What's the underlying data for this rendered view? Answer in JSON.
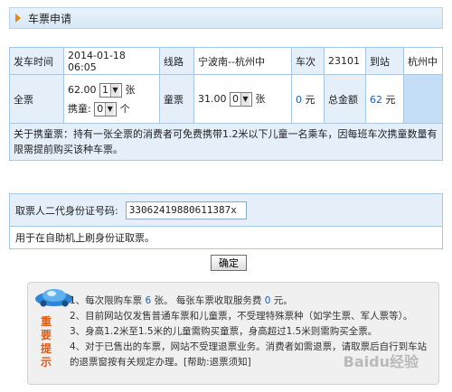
{
  "header": {
    "title": "车票申请"
  },
  "ticket": {
    "depart_time_label": "发车时间",
    "depart_time": "2014-01-18 06:05",
    "route_label": "线路",
    "route": "宁波南--杭州中",
    "train_no_label": "车次",
    "train_no": "23101",
    "arrive_label": "到站",
    "arrive": "杭州中",
    "full_label": "全票",
    "full_price": "62.00",
    "full_qty": "1",
    "full_unit": "张",
    "carry_label": "携童:",
    "carry_qty": "0",
    "carry_unit": "个",
    "child_label": "童票",
    "child_price": "31.00",
    "child_qty": "0",
    "child_unit": "张",
    "child_total": "0",
    "yuan": "元",
    "total_label": "总金额",
    "total_amount": "62",
    "note": "关于携童票：持有一张全票的消费者可免费携带1.2米以下儿童一名乘车，因每班车次携童数量有限需提前购买该种车票。"
  },
  "identity": {
    "label": "取票人二代身份证号码:",
    "value": "33062419880611387x",
    "note": "用于在自助机上刷身份证取票。"
  },
  "confirm_label": "确定",
  "notice": {
    "badge": [
      "重",
      "要",
      "提",
      "示"
    ],
    "line1_a": "1、每次限购车票 ",
    "line1_num": "6",
    "line1_b": " 张。 每张车票收取服务费 ",
    "line1_fee": "0",
    "line1_c": " 元。",
    "line2": "2、目前网站仅发售普通车票和儿童票，不受理特殊票种（如学生票、军人票等）。",
    "line3": "3、身高1.2米至1.5米的儿童需购买童票，身高超过1.5米则需购买全票。",
    "line4": "4、对于已售出的车票，网站不受理退票业务。消费者如需退票，请取票后自行到车站的退票窗按有关规定办理。[帮助:退票须知]",
    "watermark": "Baidu经验"
  },
  "colors": {
    "accent": "#1a5fc5",
    "warning": "#e05a10",
    "cell_label_bg": "#e4eff9",
    "highlight_cell": "#c3def5"
  }
}
